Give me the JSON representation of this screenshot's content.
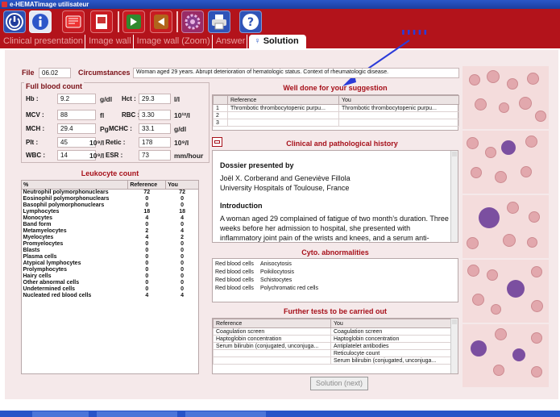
{
  "window": {
    "title": "e-HEMATimage utilisateur"
  },
  "toolbar": {
    "icons": [
      "power-icon",
      "info-icon",
      "book-icon",
      "print-preview-icon",
      "forward-icon",
      "back-icon",
      "settings-icon",
      "printer-icon",
      "help-icon"
    ]
  },
  "annotation": {
    "text": "!!!!!"
  },
  "tabs": [
    {
      "label": "Clinical presentation"
    },
    {
      "label": "Image wall"
    },
    {
      "label": "Image wall (Zoom)"
    },
    {
      "label": "Answer"
    },
    {
      "label": "Solution"
    }
  ],
  "file": {
    "label": "File",
    "value": "06.02"
  },
  "circumstances": {
    "label": "Circumstances",
    "value": "Woman aged 29 years. Abrupt deterioration of hematologic status. Context of rheumatologic disease."
  },
  "fbc": {
    "title": "Full blood count",
    "hb": {
      "label": "Hb :",
      "value": "9.2",
      "unit": "g/dl"
    },
    "hct": {
      "label": "Hct :",
      "value": "29.3",
      "unit": "l/l"
    },
    "mcv": {
      "label": "MCV :",
      "value": "88",
      "unit": "fl"
    },
    "rbc": {
      "label": "RBC :",
      "value": "3.30",
      "unit": "10¹²/l"
    },
    "mch": {
      "label": "MCH :",
      "value": "29.4",
      "unit": "Pg"
    },
    "mchc": {
      "label": "MCHC :",
      "value": "33.1",
      "unit": "g/dl"
    },
    "plt": {
      "label": "Plt :",
      "value": "45",
      "unit": "10⁹/l"
    },
    "retic": {
      "label": "Retic :",
      "value": "178",
      "unit": "10⁹/l"
    },
    "wbc": {
      "label": "WBC :",
      "value": "14",
      "unit": "10⁹/l"
    },
    "esr": {
      "label": "ESR :",
      "value": "73",
      "unit": "mm/hour"
    }
  },
  "leukocyte": {
    "title": "Leukocyte count",
    "headers": [
      "%",
      "Reference",
      "You"
    ],
    "rows": [
      [
        "Neutrophil polymorphonuclears",
        "72",
        "72"
      ],
      [
        "Eosinophil polymorphonuclears",
        "0",
        "0"
      ],
      [
        "Basophil polymorphonuclears",
        "0",
        "0"
      ],
      [
        "Lymphocytes",
        "18",
        "18"
      ],
      [
        "Monocytes",
        "4",
        "4"
      ],
      [
        "Band form",
        "0",
        "0"
      ],
      [
        "Metamyelocytes",
        "2",
        "4"
      ],
      [
        "Myelocytes",
        "4",
        "2"
      ],
      [
        "Promyelocytes",
        "0",
        "0"
      ],
      [
        "Blasts",
        "0",
        "0"
      ],
      [
        "Plasma cells",
        "0",
        "0"
      ],
      [
        "Atypical lymphocytes",
        "0",
        "0"
      ],
      [
        "Prolymphocytes",
        "0",
        "0"
      ],
      [
        "Hairy cells",
        "0",
        "0"
      ],
      [
        "Other abnormal cells",
        "0",
        "0"
      ],
      [
        "Undetermined cells",
        "0",
        "0"
      ],
      [
        "Nucleated red blood cells",
        "4",
        "4"
      ]
    ]
  },
  "suggestion": {
    "title": "Well done for your suggestion",
    "headers": [
      "",
      "Reference",
      "You"
    ],
    "rows": [
      [
        "1",
        "Thrombotic thrombocytopenic purpu...",
        "Thrombotic thrombocytopenic purpu..."
      ],
      [
        "2",
        "",
        ""
      ],
      [
        "3",
        "",
        ""
      ]
    ]
  },
  "history": {
    "title": "Clinical and pathological history",
    "heading1": "Dossier presented by",
    "authors": "Joël X. Corberand and Geneviève Fillola",
    "affiliation": "University Hospitals of Toulouse, France",
    "heading2": "Introduction",
    "intro": "A woman aged 29 complained of fatigue of two month’s duration. Three weeks before her admission to hospital, she presented with inflammatory joint pain of the wrists and knees, and a serum anti-"
  },
  "cyto": {
    "title": "Cyto. abnormalities",
    "rows": [
      [
        "Red blood cells",
        "Anisocytosis"
      ],
      [
        "Red blood cells",
        "Poikilocytosis"
      ],
      [
        "Red blood cells",
        "Schistocytes"
      ],
      [
        "Red blood cells",
        "Polychromatic red cells"
      ]
    ]
  },
  "tests": {
    "title": "Further tests to be carried out",
    "headers": [
      "Reference",
      "You"
    ],
    "rows": [
      [
        "Coagulation screen",
        "Coagulation screen"
      ],
      [
        "Haptoglobin concentration",
        "Haptoglobin concentration"
      ],
      [
        "Serum bilirubin (conjugated, unconjuga...",
        "Antiplatelet antibodies"
      ],
      [
        "",
        "Reticulocyte count"
      ],
      [
        "",
        "Serum bilirubin (conjugated, unconjuga..."
      ]
    ]
  },
  "buttons": {
    "next": "Solution (next)"
  }
}
